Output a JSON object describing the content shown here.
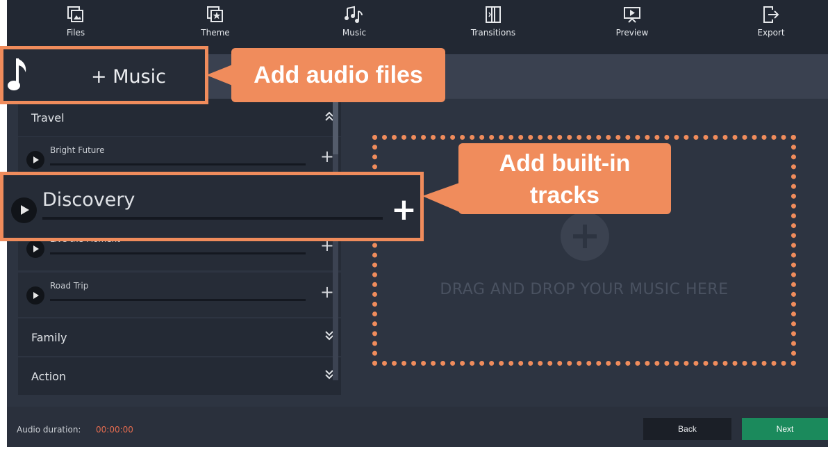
{
  "toolbar": {
    "items": [
      {
        "label": "Files",
        "icon": "files-icon"
      },
      {
        "label": "Theme",
        "icon": "theme-icon"
      },
      {
        "label": "Music",
        "icon": "music-icon"
      },
      {
        "label": "Transitions",
        "icon": "transitions-icon"
      },
      {
        "label": "Preview",
        "icon": "preview-icon"
      },
      {
        "label": "Export",
        "icon": "export-icon"
      }
    ]
  },
  "add_music": {
    "label": "+ Music",
    "icon": "music-note-icon"
  },
  "library": {
    "categories": [
      {
        "name": "Travel",
        "expanded": true,
        "tracks": [
          "Bright Future",
          "Discovery",
          "Live the Moment",
          "Road Trip"
        ]
      },
      {
        "name": "Family",
        "expanded": false
      },
      {
        "name": "Action",
        "expanded": false
      }
    ]
  },
  "drop_area": {
    "text": "DRAG AND DROP YOUR MUSIC HERE"
  },
  "footer": {
    "duration_label": "Audio duration:",
    "duration_value": "00:00:00",
    "back_label": "Back",
    "next_label": "Next"
  },
  "callouts": {
    "audio_files": "Add audio files",
    "built_in_line1": "Add built-in",
    "built_in_line2": "tracks"
  },
  "colors": {
    "accent": "#f08c5c",
    "background": "#2d3441",
    "toolbar": "#222833",
    "next_button": "#1b8a5c",
    "duration_value": "#e26b4f"
  }
}
